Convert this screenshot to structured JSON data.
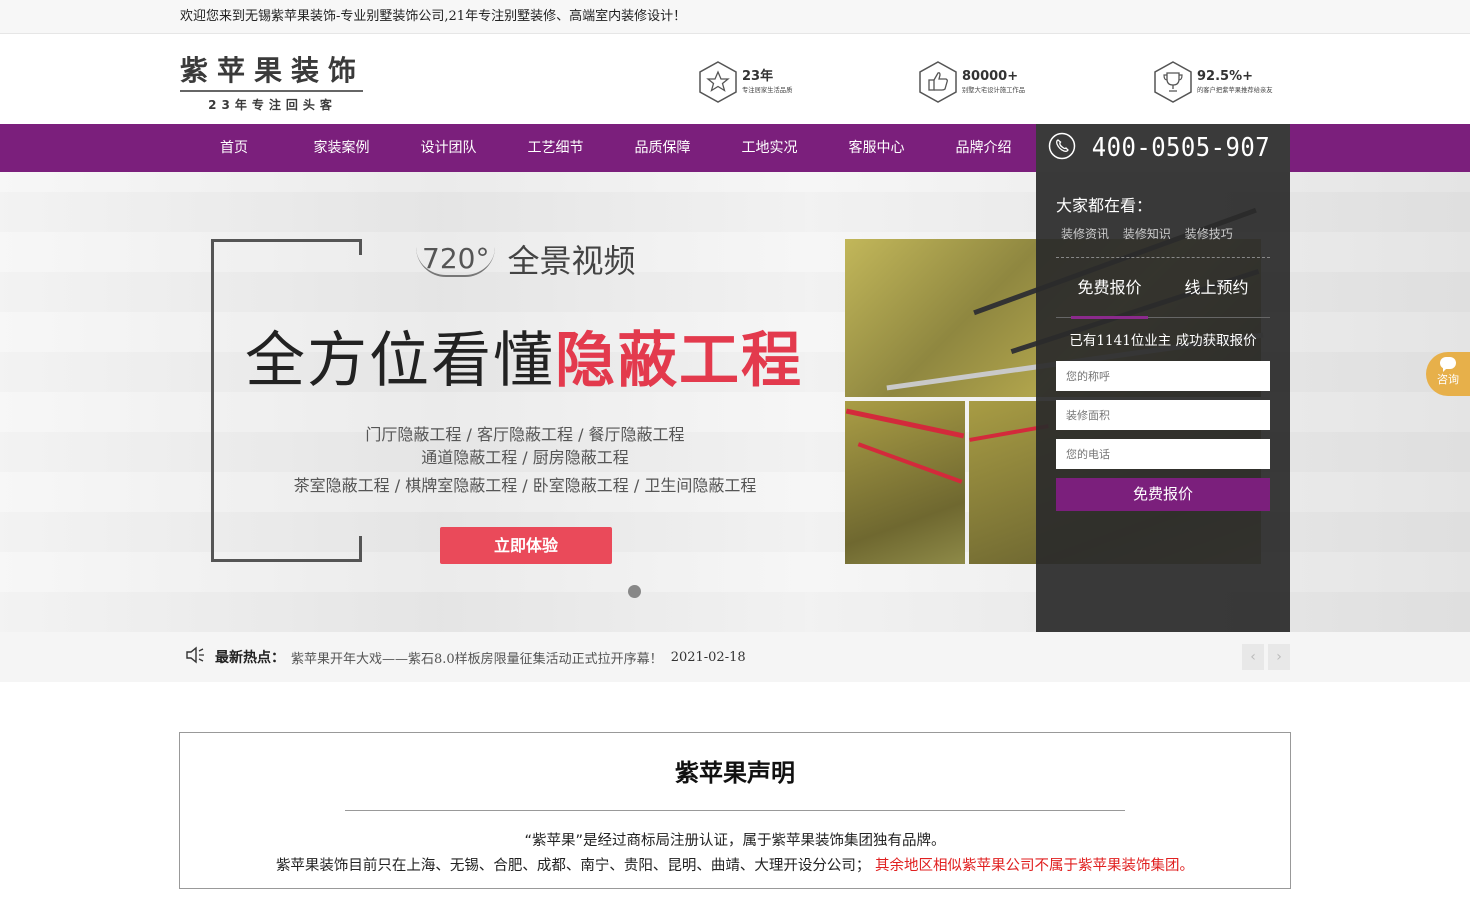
{
  "topbar": {
    "welcome": "欢迎您来到无锡紫苹果装饰-专业别墅装饰公司,21年专注别墅装修、高端室内装修设计！"
  },
  "logo": {
    "name": "紫苹果装饰",
    "tagline": "23年专注回头客"
  },
  "stats": [
    {
      "icon": "star-icon",
      "value": "23年",
      "caption": "专注居家生活品质"
    },
    {
      "icon": "thumbs-up-icon",
      "value": "80000+",
      "caption": "别墅大宅设计施工作品"
    },
    {
      "icon": "trophy-icon",
      "value": "92.5%+",
      "caption": "的客户把紫苹果推荐给亲友"
    }
  ],
  "nav": {
    "items": [
      "首页",
      "家装案例",
      "设计团队",
      "工艺细节",
      "品质保障",
      "工地实况",
      "客服中心",
      "品牌介绍"
    ],
    "phone": "400-0505-907"
  },
  "banner": {
    "vr_number": "720°",
    "vr_label": "全景视频",
    "headline_black": "全方位看懂",
    "headline_red": "隐蔽工程",
    "rooms_line1": "门厅隐蔽工程   /   客厅隐蔽工程   /   餐厅隐蔽工程",
    "rooms_line2": "通道隐蔽工程   /   厨房隐蔽工程",
    "rooms_line3": "茶室隐蔽工程   /   棋牌室隐蔽工程  /   卧室隐蔽工程   /   卫生间隐蔽工程",
    "cta": "立即体验"
  },
  "panel": {
    "heading": "大家都在看：",
    "links": [
      "装修资讯",
      "装修知识",
      "装修技巧"
    ],
    "tabs": [
      "免费报价",
      "线上预约"
    ],
    "subtitle": "已有1141位业主 成功获取报价",
    "name_placeholder": "您的称呼",
    "area_placeholder": "装修面积",
    "phone_placeholder": "您的电话",
    "submit": "免费报价"
  },
  "consult": {
    "label": "咨询"
  },
  "news": {
    "label": "最新热点：",
    "item": "紫苹果开年大戏——紫石8.0样板房限量征集活动正式拉开序幕！",
    "date": "2021-02-18",
    "prev": "‹",
    "next": "›"
  },
  "statement": {
    "title": "紫苹果声明",
    "line1": "“紫苹果”是经过商标局注册认证，属于紫苹果装饰集团独有品牌。",
    "line2": "紫苹果装饰目前只在上海、无锡、合肥、成都、南宁、贵阳、昆明、曲靖、大理开设分公司；",
    "line2_red": "其余地区相似紫苹果公司不属于紫苹果装饰集团。"
  }
}
